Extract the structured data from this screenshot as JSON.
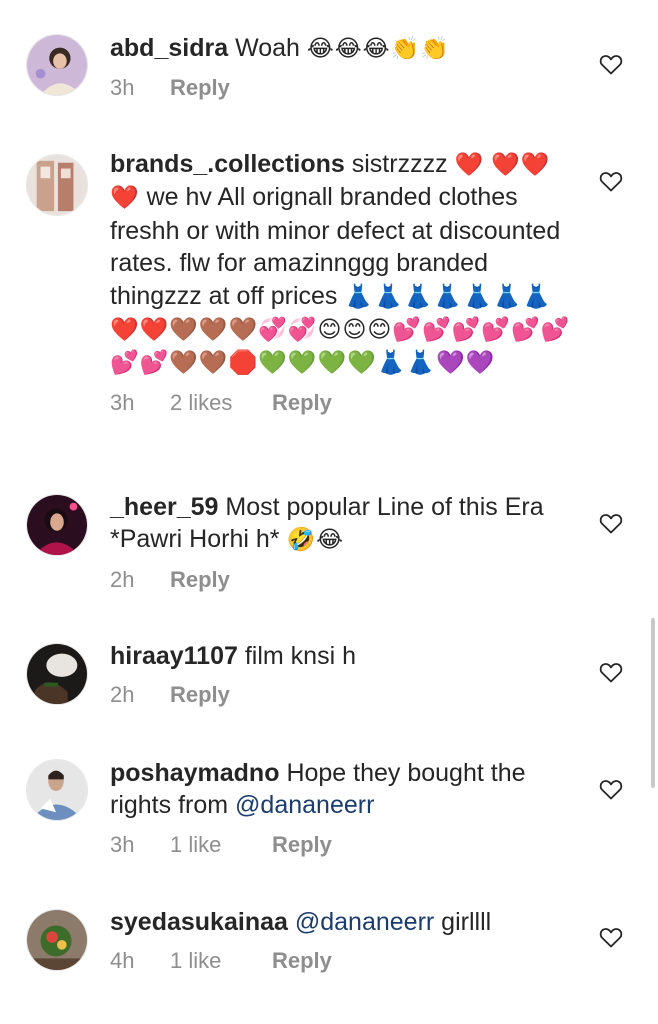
{
  "comments": [
    {
      "username": "abd_sidra",
      "text": "Woah",
      "emoji": "😂😂😂👏👏",
      "time": "3h",
      "likes": "",
      "reply": "Reply"
    },
    {
      "username": "brands_.collections",
      "text": "sistrzzzz",
      "emoji_inline": "❤️",
      "line2_emoji": "❤️❤️❤️",
      "text2": "we hv All orignall branded clothes freshh or with minor defect at discounted rates. flw for amazinnggg branded thingzzz  at off prices",
      "emoji_tail": "👗👗👗👗👗👗👗❤️❤️🤎🤎🤎💞💞😊😊😊💕💕💕💕💕💕💕💕🤎🤎🛑💚💚💚💚👗👗💜💜",
      "time": "3h",
      "likes": "2 likes",
      "reply": "Reply"
    },
    {
      "username": "_heer_59",
      "text": "Most popular Line of this Era *Pawri Horhi h*",
      "emoji": "🤣😂",
      "time": "2h",
      "likes": "",
      "reply": "Reply"
    },
    {
      "username": "hiraay1107",
      "text": "film knsi h",
      "time": "2h",
      "likes": "",
      "reply": "Reply"
    },
    {
      "username": "poshaymadno",
      "text": "Hope they bought the rights from",
      "mention": "@dananeerr",
      "time": "3h",
      "likes": "1 like",
      "reply": "Reply"
    },
    {
      "username": "syedasukainaa",
      "mention": "@dananeerr",
      "text": "girllll",
      "time": "4h",
      "likes": "1 like",
      "reply": "Reply"
    }
  ],
  "colors": {
    "text": "#262626",
    "meta": "#8e8e8e",
    "mention": "#1b3c6e"
  },
  "icons": {
    "like": "heart-outline-icon"
  }
}
